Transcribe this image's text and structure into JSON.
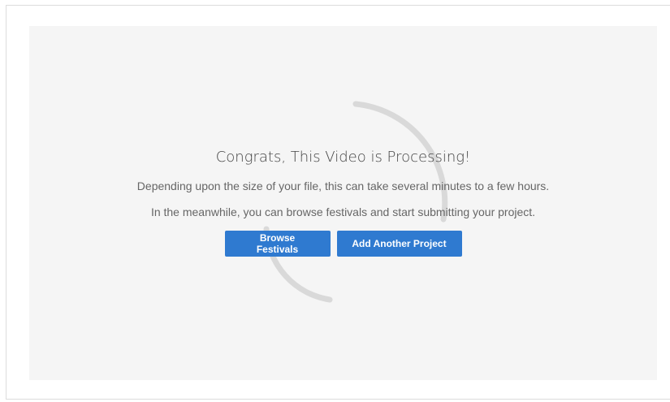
{
  "processing": {
    "title": "Congrats, This Video is Processing!",
    "line1": "Depending upon the size of your file, this can take several minutes to a few hours.",
    "line2": "In the meanwhile, you can browse festivals and start submitting your project."
  },
  "actions": {
    "browse_label": "Browse Festivals",
    "add_label": "Add Another Project"
  },
  "colors": {
    "button_bg": "#2f7ad0",
    "panel_bg": "#f5f5f5",
    "spinner": "#d9d9d9"
  },
  "icons": {
    "spinner": "loading-spinner-icon"
  }
}
